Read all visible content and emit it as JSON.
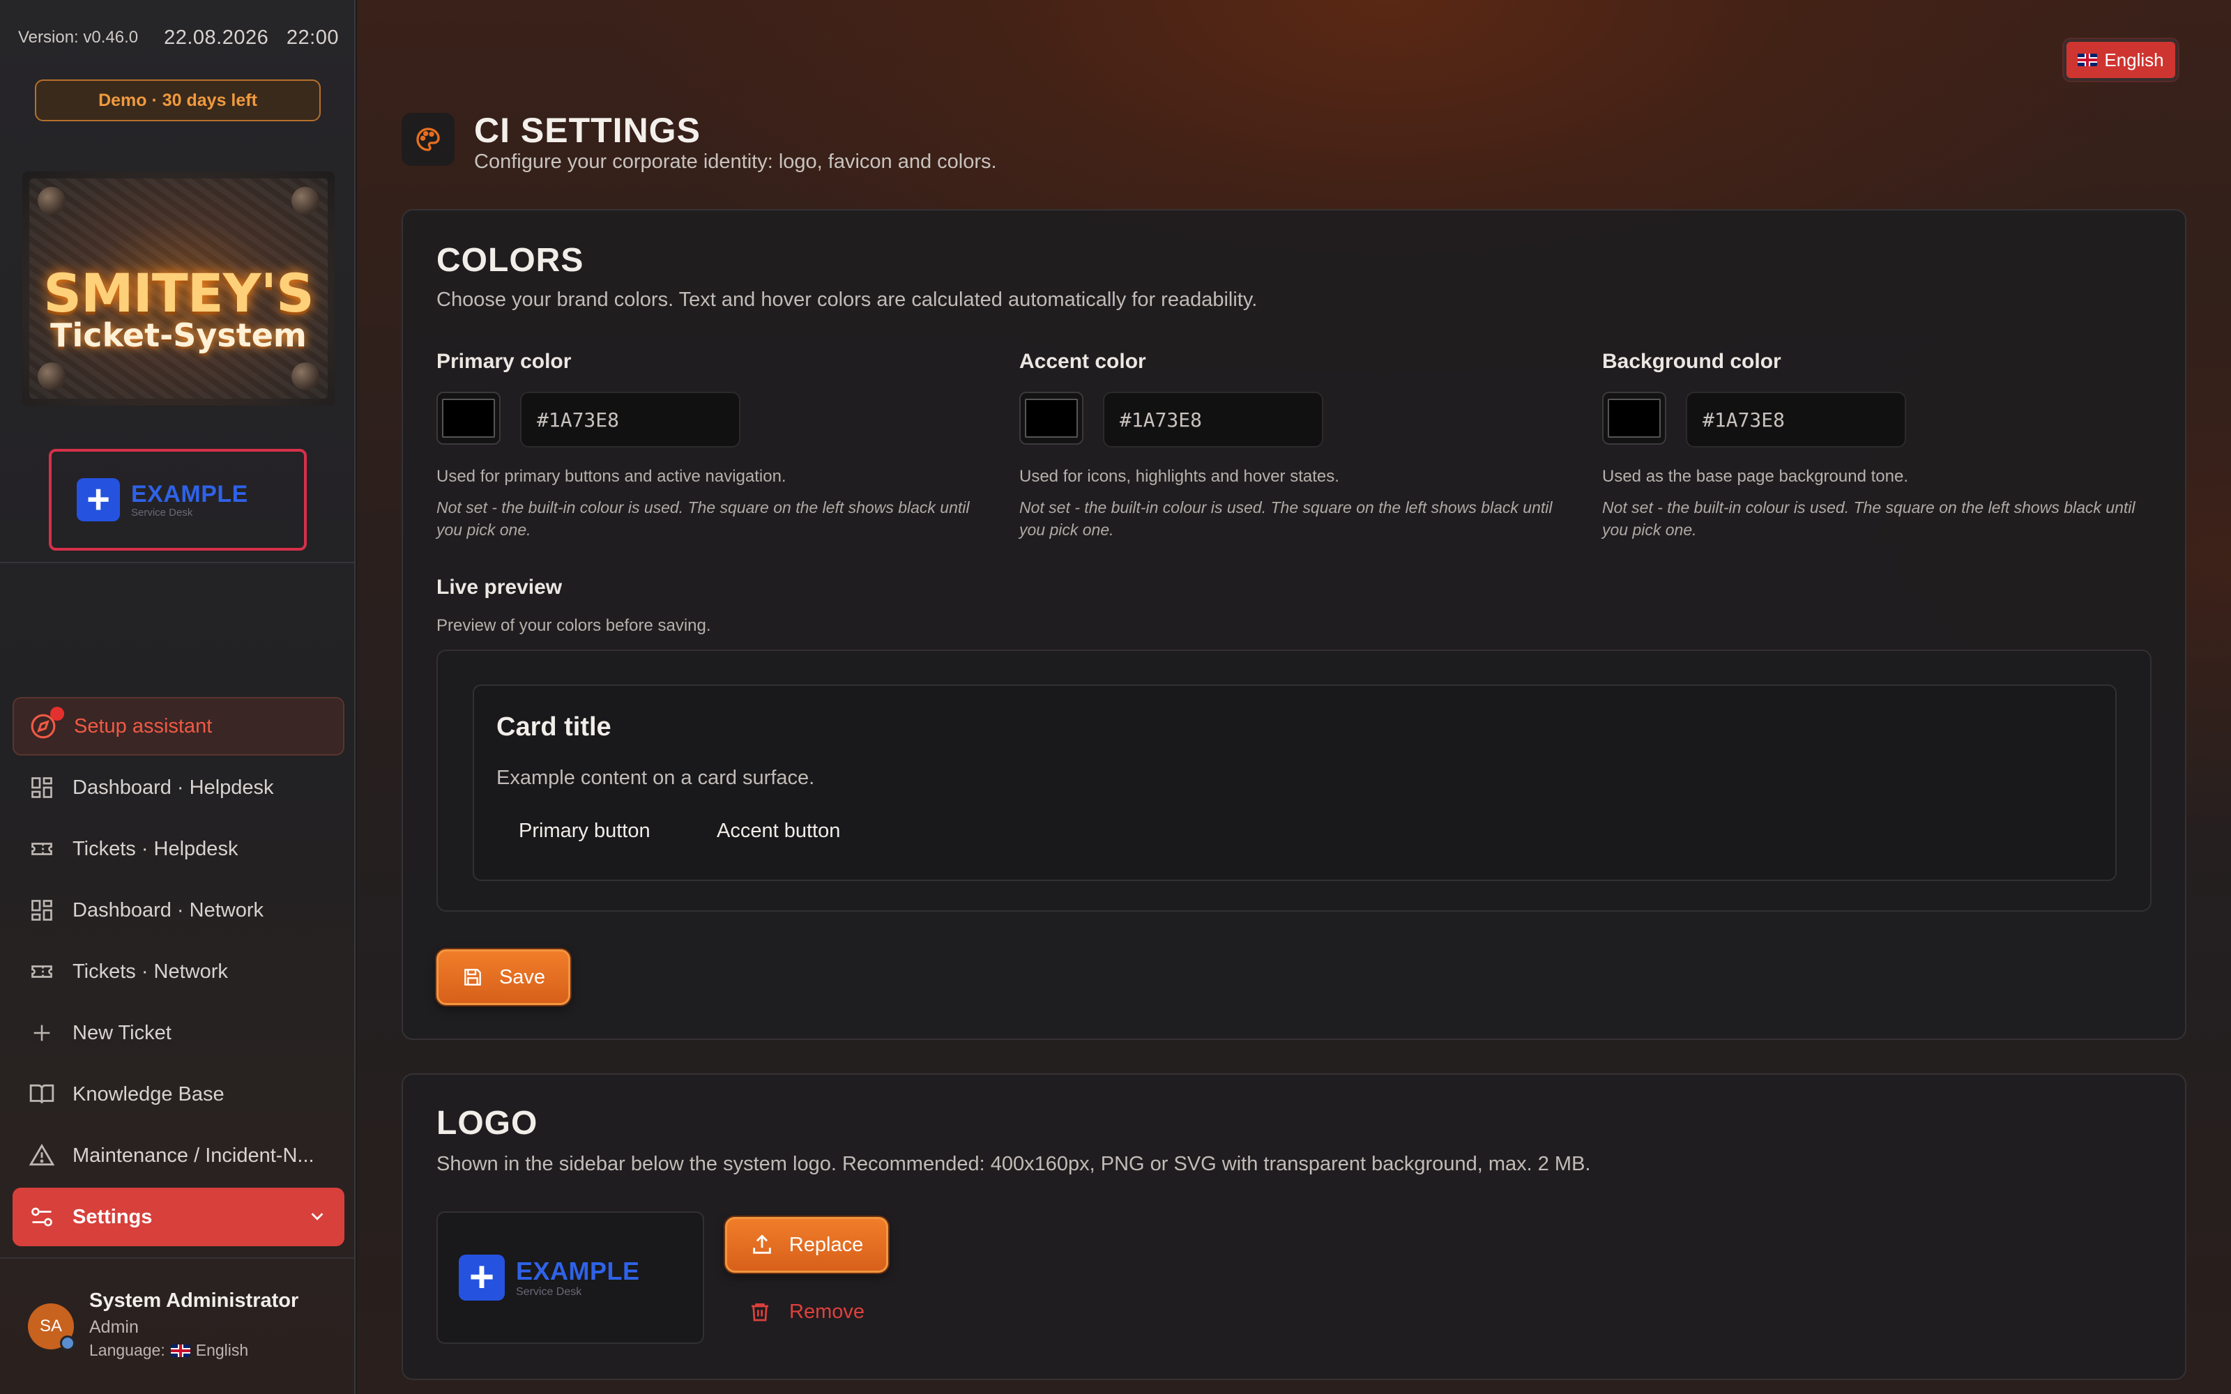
{
  "app": {
    "version": "Version: v0.46.0",
    "date": "22.08.2026",
    "time": "22:00",
    "demo_badge": "Demo · 30 days left",
    "system_logo": {
      "line1": "SMITEY'S",
      "line2": "Ticket-System"
    },
    "client_logo": {
      "name": "EXAMPLE",
      "tagline": "Service Desk",
      "icon": "plus-icon",
      "color": "#2553e0"
    }
  },
  "sidebar": {
    "items": [
      {
        "label": "Setup assistant",
        "icon": "compass-icon",
        "state": "alert"
      },
      {
        "label": "Dashboard · Helpdesk",
        "icon": "grid-icon"
      },
      {
        "label": "Tickets · Helpdesk",
        "icon": "ticket-icon"
      },
      {
        "label": "Dashboard · Network",
        "icon": "grid-icon"
      },
      {
        "label": "Tickets · Network",
        "icon": "ticket-icon"
      },
      {
        "label": "New Ticket",
        "icon": "plus-icon"
      },
      {
        "label": "Knowledge Base",
        "icon": "book-icon"
      },
      {
        "label": "Maintenance / Incident-N...",
        "icon": "warning-icon"
      },
      {
        "label": "Settings",
        "icon": "sliders-icon",
        "state": "active"
      }
    ]
  },
  "user": {
    "initials": "SA",
    "name": "System Administrator",
    "role": "Admin",
    "language_label": "Language:",
    "language": "English"
  },
  "header": {
    "language_button": "English"
  },
  "page": {
    "title": "CI SETTINGS",
    "subtitle": "Configure your corporate identity: logo, favicon and colors.",
    "icon": "palette-icon"
  },
  "colors_card": {
    "title": "COLORS",
    "description": "Choose your brand colors. Text and hover colors are calculated automatically for readability.",
    "fields": [
      {
        "label": "Primary color",
        "value": "#1A73E8",
        "help": "Used for primary buttons and active navigation.",
        "note": "Not set - the built-in colour is used. The square on the left shows black until you pick one."
      },
      {
        "label": "Accent color",
        "value": "#1A73E8",
        "help": "Used for icons, highlights and hover states.",
        "note": "Not set - the built-in colour is used. The square on the left shows black until you pick one."
      },
      {
        "label": "Background color",
        "value": "#1A73E8",
        "help": "Used as the base page background tone.",
        "note": "Not set - the built-in colour is used. The square on the left shows black until you pick one."
      }
    ],
    "preview": {
      "label": "Live preview",
      "sublabel": "Preview of your colors before saving.",
      "card_title": "Card title",
      "card_text": "Example content on a card surface.",
      "primary_button": "Primary button",
      "accent_button": "Accent button"
    },
    "save_label": "Save"
  },
  "logo_card": {
    "title": "LOGO",
    "description": "Shown in the sidebar below the system logo. Recommended: 400x160px, PNG or SVG with transparent background, max. 2 MB.",
    "replace_label": "Replace",
    "remove_label": "Remove"
  },
  "theme": {
    "accent": "#d8403b",
    "button": "#e8701f",
    "danger": "#e0403d"
  }
}
